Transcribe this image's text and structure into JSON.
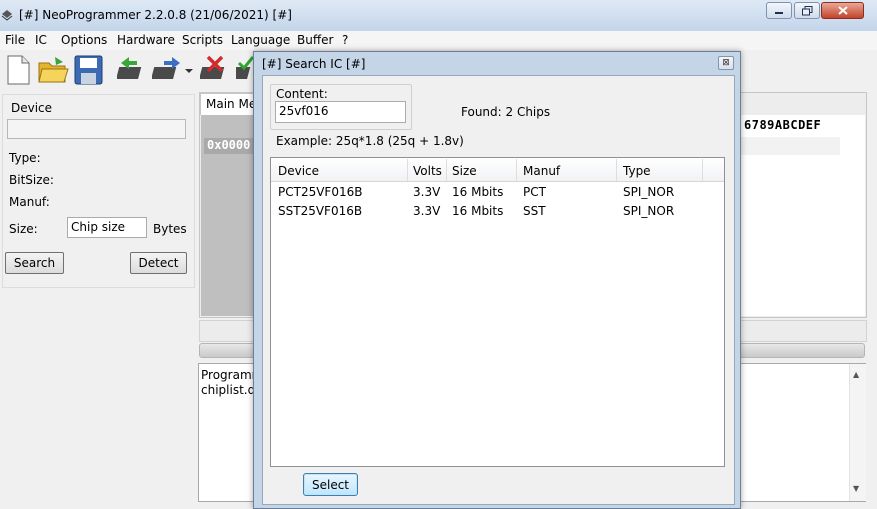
{
  "window": {
    "title": "[#] NeoProgrammer 2.2.0.8 (21/06/2021) [#]"
  },
  "menu": {
    "items": [
      "File",
      "IC",
      "Options",
      "Hardware",
      "Scripts",
      "Language",
      "Buffer",
      "?"
    ]
  },
  "toolbar": {
    "icons": [
      "new-file-icon",
      "open-folder-icon",
      "save-disk-icon",
      "read-chip-icon",
      "write-chip-icon",
      "dropdown-arrow-icon",
      "erase-chip-icon",
      "verify-chip-icon"
    ]
  },
  "left_panel": {
    "device_label": "Device",
    "device_value": "",
    "type_label": "Type:",
    "bitsize_label": "BitSize:",
    "manuf_label": "Manuf:",
    "size_label": "Size:",
    "size_value": "Chip size",
    "bytes_label": "Bytes",
    "search_button": "Search",
    "detect_button": "Detect"
  },
  "main_area": {
    "tab_label": "Main Me",
    "hex_address": "0x0000",
    "hex_header": "6789ABCDEF",
    "log_lines": [
      "Programm",
      "chiplist.da"
    ]
  },
  "dialog": {
    "title": "[#] Search IC [#]",
    "close_glyph": "⊠",
    "content_label": "Content:",
    "content_value": "25vf016",
    "found_text": "Found: 2  Chips",
    "example_text": "Example:  25q*1.8 (25q + 1.8v)",
    "columns": [
      "Device",
      "Volts",
      "Size",
      "Manuf",
      "Type"
    ],
    "rows": [
      {
        "device": "PCT25VF016B",
        "volts": "3.3V",
        "size": "16 Mbits",
        "manuf": "PCT",
        "type": "SPI_NOR"
      },
      {
        "device": "SST25VF016B",
        "volts": "3.3V",
        "size": "16 Mbits",
        "manuf": "SST",
        "type": "SPI_NOR"
      }
    ],
    "select_button": "Select"
  },
  "colors": {
    "title_gradient_top": "#dfe9f5",
    "dialog_frame": "#c5d5e8",
    "select_button": "#bee6fd",
    "close_button": "#c2442b"
  }
}
